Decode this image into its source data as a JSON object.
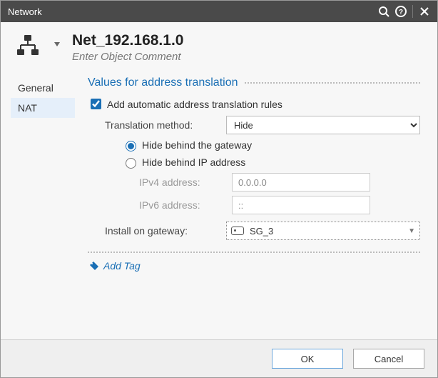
{
  "window": {
    "title": "Network"
  },
  "object": {
    "name": "Net_192.168.1.0",
    "comment_placeholder": "Enter Object Comment"
  },
  "sidebar": {
    "items": [
      {
        "label": "General"
      },
      {
        "label": "NAT"
      }
    ]
  },
  "nat": {
    "section_title": "Values for address translation",
    "add_auto_label": "Add automatic address translation rules",
    "add_auto_checked": true,
    "method_label": "Translation method:",
    "method_value": "Hide",
    "hide_gateway_label": "Hide behind the gateway",
    "hide_ip_label": "Hide behind IP address",
    "hide_selected": "gateway",
    "ipv4_label": "IPv4 address:",
    "ipv4_value": "0.0.0.0",
    "ipv6_label": "IPv6 address:",
    "ipv6_value": "::",
    "install_label": "Install on gateway:",
    "install_value": "SG_3"
  },
  "tags": {
    "add_label": "Add Tag"
  },
  "footer": {
    "ok": "OK",
    "cancel": "Cancel"
  }
}
